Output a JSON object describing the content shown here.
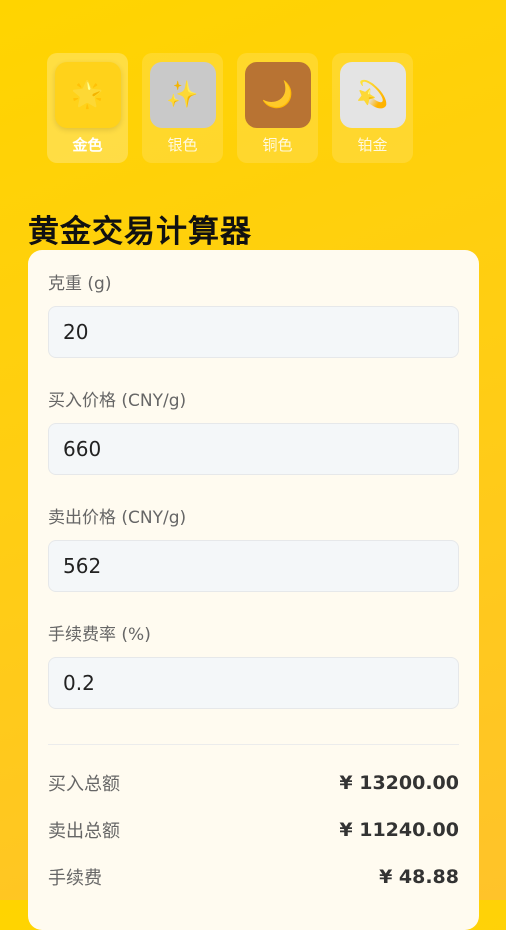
{
  "themes": [
    {
      "label": "金色",
      "icon": "star-icon",
      "glyph": "🌟",
      "color": "#FFD21A",
      "selected": true
    },
    {
      "label": "银色",
      "icon": "sparkles-icon",
      "glyph": "✨",
      "color": "#C9C9C9",
      "selected": false
    },
    {
      "label": "铜色",
      "icon": "moon-icon",
      "glyph": "🌙",
      "color": "#B87333",
      "selected": false
    },
    {
      "label": "铂金",
      "icon": "dizzy-star-icon",
      "glyph": "💫",
      "color": "#E4E4E4",
      "selected": false
    }
  ],
  "title": "黄金交易计算器",
  "fields": [
    {
      "label": "克重 (g)",
      "value": "20"
    },
    {
      "label": "买入价格 (CNY/g)",
      "value": "660"
    },
    {
      "label": "卖出价格 (CNY/g)",
      "value": "562"
    },
    {
      "label": "手续费率 (%)",
      "value": "0.2"
    }
  ],
  "results": [
    {
      "label": "买入总额",
      "value": "¥ 13200.00"
    },
    {
      "label": "卖出总额",
      "value": "¥ 11240.00"
    },
    {
      "label": "手续费",
      "value": "¥ 48.88"
    }
  ]
}
